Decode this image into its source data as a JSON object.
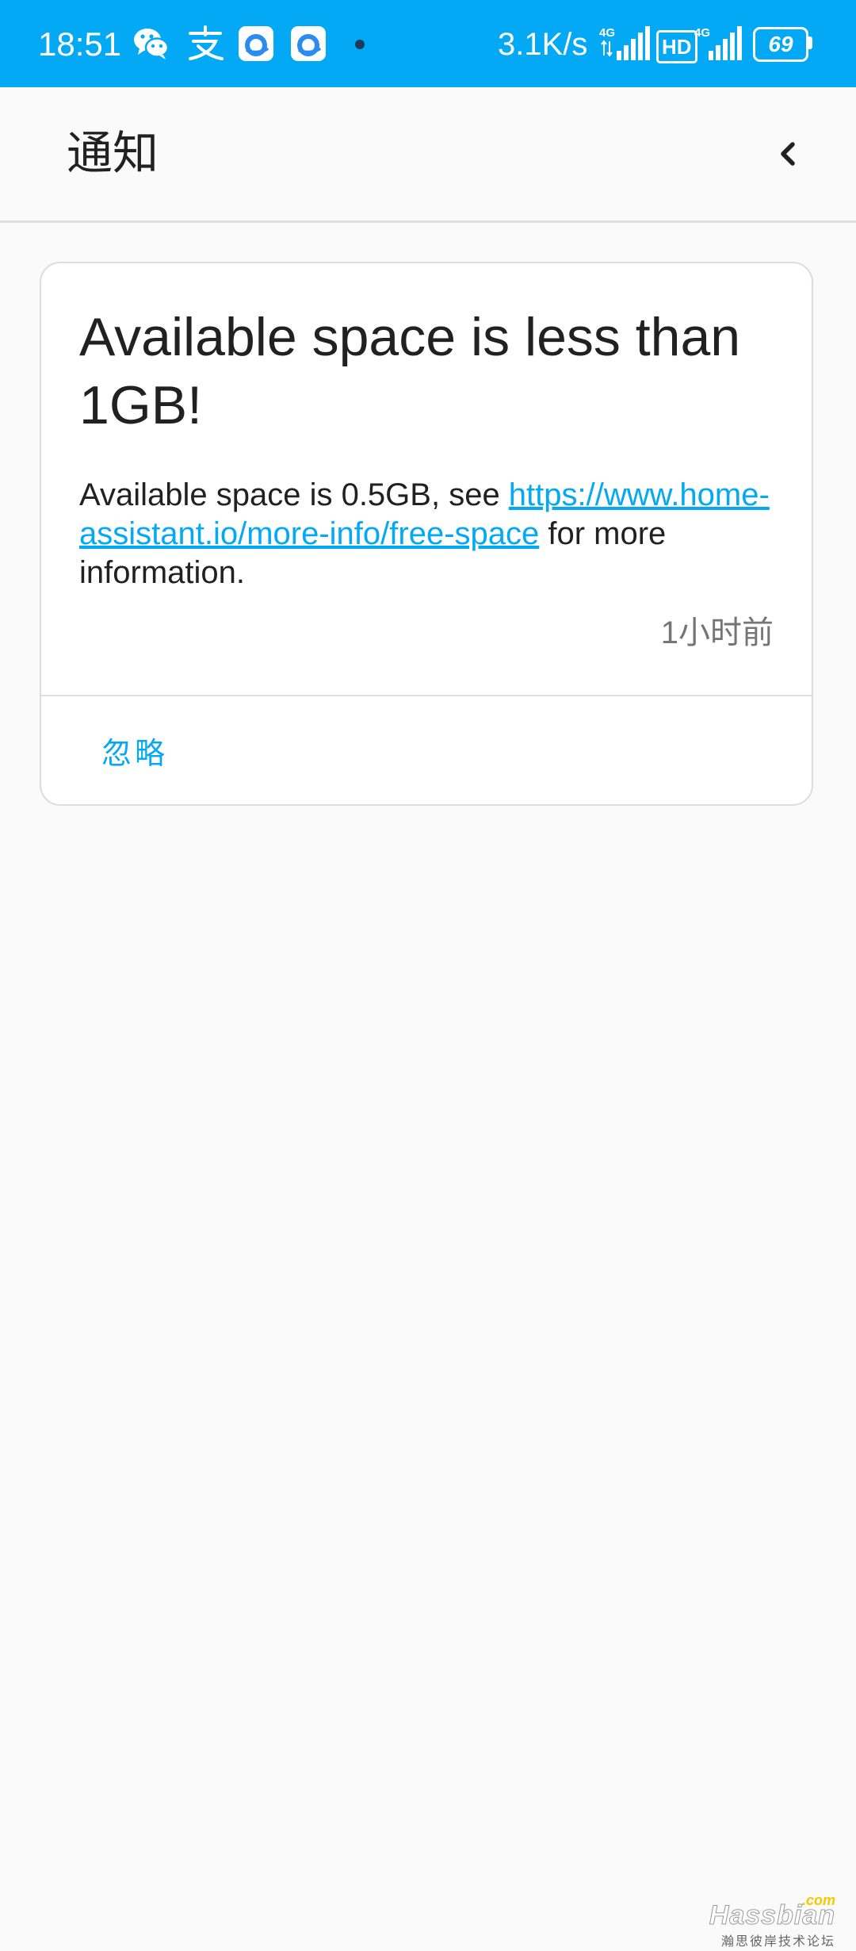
{
  "status_bar": {
    "time": "18:51",
    "net_speed": "3.1K/s",
    "sim1_type": "4G",
    "hd_label": "HD",
    "sim2_type": "4G",
    "battery_level": "69",
    "icons": [
      "wechat-icon",
      "alipay-icon",
      "app-icon",
      "app-icon",
      "dot-icon",
      "signal-icon",
      "hd-icon",
      "signal-icon",
      "battery-icon"
    ]
  },
  "header": {
    "title": "通知",
    "back_icon": "chevron-left-icon"
  },
  "notification": {
    "title": "Available space is less than 1GB!",
    "message_prefix": "Available space is 0.5GB, see ",
    "link_text": "https://www.home-assistant.io/more-info/free-space",
    "message_suffix": " for more information.",
    "timestamp": "1小时前",
    "dismiss_label": "忽略"
  },
  "watermark": {
    "com": ".com",
    "brand": "Hassbian",
    "subtitle": "瀚思彼岸技术论坛"
  },
  "colors": {
    "status_bar_bg": "#03a9f4",
    "accent": "#03a9f4",
    "page_bg": "#fafafa",
    "card_bg": "#ffffff",
    "primary_text": "#212121",
    "secondary_text": "#757575"
  }
}
